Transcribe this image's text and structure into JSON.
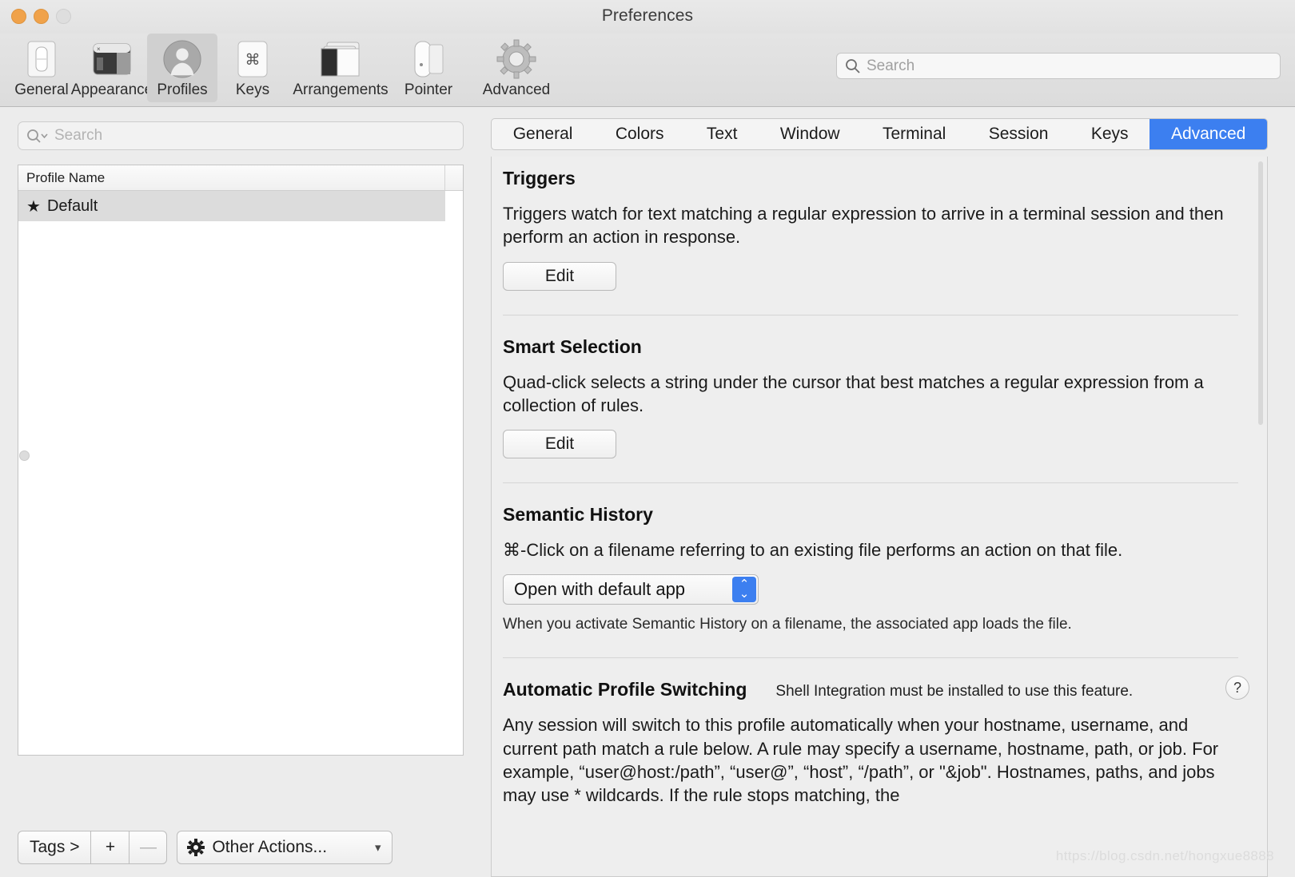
{
  "window": {
    "title": "Preferences",
    "traffic_lights": [
      "close",
      "minimize",
      "zoom"
    ]
  },
  "toolbar": {
    "items": [
      {
        "label": "General",
        "icon": "general-switch-icon"
      },
      {
        "label": "Appearance",
        "icon": "appearance-window-icon"
      },
      {
        "label": "Profiles",
        "icon": "profiles-person-icon",
        "selected": true
      },
      {
        "label": "Keys",
        "icon": "keys-command-icon"
      },
      {
        "label": "Arrangements",
        "icon": "arrangements-windows-icon"
      },
      {
        "label": "Pointer",
        "icon": "pointer-mouse-icon"
      },
      {
        "label": "Advanced",
        "icon": "advanced-gear-icon"
      }
    ],
    "search": {
      "placeholder": "Search",
      "value": "",
      "icon": "search-icon"
    }
  },
  "sidebar": {
    "search": {
      "placeholder": "Search",
      "value": "",
      "icon": "search-dropdown-icon"
    },
    "table": {
      "columns": [
        "Profile Name"
      ],
      "rows": [
        {
          "name": "Default",
          "badge": "★",
          "selected": true
        }
      ]
    },
    "bottom_bar": {
      "tags_label": "Tags >",
      "add_label": "+",
      "remove_label": "—",
      "other_actions_label": "Other Actions...",
      "other_actions_icon": "gear-icon",
      "chevron_icon": "chevron-down-icon"
    }
  },
  "main": {
    "tabs": [
      {
        "label": "General",
        "active": false
      },
      {
        "label": "Colors",
        "active": false
      },
      {
        "label": "Text",
        "active": false
      },
      {
        "label": "Window",
        "active": false
      },
      {
        "label": "Terminal",
        "active": false
      },
      {
        "label": "Session",
        "active": false
      },
      {
        "label": "Keys",
        "active": false
      },
      {
        "label": "Advanced",
        "active": true
      }
    ],
    "accent_color": "#3c7ff0",
    "sections": {
      "triggers": {
        "heading": "Triggers",
        "description": "Triggers watch for text matching a regular expression to arrive in a terminal session and then perform an action in response.",
        "button": "Edit"
      },
      "smart_selection": {
        "heading": "Smart Selection",
        "description": "Quad-click selects a string under the cursor that best matches a regular expression from a collection of rules.",
        "button": "Edit"
      },
      "semantic_history": {
        "heading": "Semantic History",
        "description": "⌘-Click on a filename referring to an existing file performs an action on that file.",
        "select_value": "Open with default app",
        "hint": "When you activate Semantic History on a filename, the associated app loads the file."
      },
      "automatic_profile_switching": {
        "heading": "Automatic Profile Switching",
        "note": "Shell Integration must be installed to use this feature.",
        "help_label": "?",
        "body": "Any session will switch to this profile automatically when your hostname, username, and current path match a rule below. A rule may specify a username, hostname, path, or job. For example, “user@host:/path”, “user@”, “host”, “/path”, or \"&job\". Hostnames, paths, and jobs may use * wildcards. If the rule stops matching, the"
      }
    }
  },
  "watermark": "https://blog.csdn.net/hongxue8888"
}
